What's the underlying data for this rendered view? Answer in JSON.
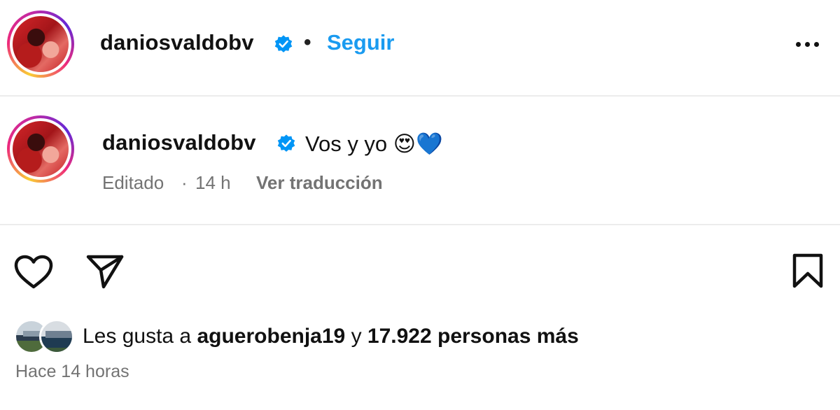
{
  "header": {
    "username": "daniosvaldobv",
    "separator": "•",
    "follow_label": "Seguir",
    "avatar_icon": "profile-avatar",
    "verified_icon": "verified-badge-icon",
    "more_icon": "more-options-icon"
  },
  "caption": {
    "username": "daniosvaldobv",
    "text": "Vos y yo 😍💙",
    "edited_label": "Editado",
    "meta_separator": "·",
    "time": "14 h",
    "translate_label": "Ver traducción"
  },
  "actions": {
    "like_icon": "heart-icon",
    "share_icon": "send-icon",
    "save_icon": "bookmark-icon"
  },
  "likes": {
    "prefix": "Les gusta a",
    "user": "aguerobenja19",
    "conjunction": "y",
    "others": "17.922 personas más"
  },
  "timestamp": "Hace 14 horas",
  "colors": {
    "link_blue": "#1a9bf0",
    "verified_blue": "#0095f6",
    "meta_gray": "#737373",
    "divider": "#ececec"
  }
}
